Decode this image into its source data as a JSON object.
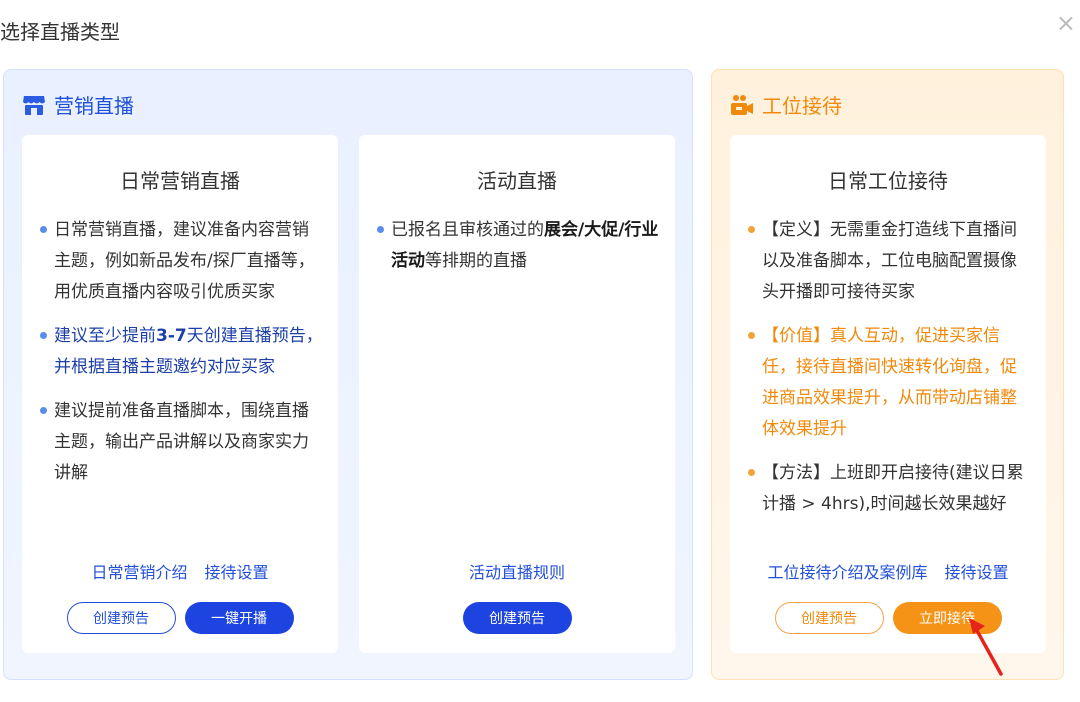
{
  "dialog": {
    "title": "选择直播类型",
    "close_label": "×"
  },
  "marketing": {
    "header": "营销直播",
    "icon": "store-icon",
    "daily": {
      "title": "日常营销直播",
      "bullets": [
        "日常营销直播，建议准备内容营销主题，例如新品发布/探厂直播等，用优质直播内容吸引优质买家",
        {
          "pre": "建议至少提前",
          "bold": "3-7",
          "post": "天创建直播预告，并根据直播主题邀约对应买家"
        },
        "建议提前准备直播脚本，围绕直播主题，输出产品讲解以及商家实力讲解"
      ],
      "links": [
        "日常营销介绍",
        "接待设置"
      ],
      "buttons": {
        "secondary": "创建预告",
        "primary": "一键开播"
      }
    },
    "event": {
      "title": "活动直播",
      "bullet": {
        "pre": "已报名且审核通过的",
        "bold": "展会/大促/行业活动",
        "post": "等排期的直播"
      },
      "links": [
        "活动直播规则"
      ],
      "buttons": {
        "primary": "创建预告"
      }
    }
  },
  "reception": {
    "header": "工位接待",
    "icon": "people-camera-icon",
    "daily": {
      "title": "日常工位接待",
      "bullets": [
        "【定义】无需重金打造线下直播间以及准备脚本，工位电脑配置摄像头开播即可接待买家",
        "【价值】真人互动，促进买家信任，接待直播间快速转化询盘，促进商品效果提升，从而带动店铺整体效果提升",
        "【方法】上班即开启接待(建议日累计播 > 4hrs),时间越长效果越好"
      ],
      "links": [
        "工位接待介绍及案例库",
        "接待设置"
      ],
      "buttons": {
        "secondary": "创建预告",
        "primary": "立即接待"
      }
    }
  },
  "colors": {
    "blue_accent": "#1d44e0",
    "orange_accent": "#f59316",
    "arrow_red": "#e5231b"
  }
}
